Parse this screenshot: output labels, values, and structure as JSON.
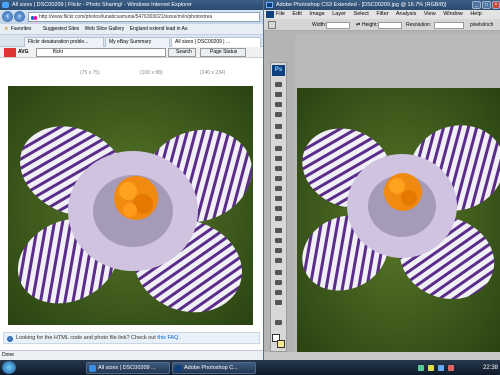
{
  "ie": {
    "title": "All sizes | DSC00209 | Flickr - Photo Sharing! - Windows Internet Explorer",
    "url": "http://www.flickr.com/photos/lunaticsamurai/5476303021/sizes/m/in/photostrea",
    "favorites_label": "Favorites",
    "suggested_sites": "Suggested Sites",
    "web_slice": "Web Slice Gallery",
    "england_link": "England extend lead in As",
    "tabs": [
      "Flickr desaturation proble...",
      "My eBay Summary",
      "All sizes | DSC00209 | ..."
    ],
    "avg_label": "AVG",
    "avg_search_value": "flickr",
    "search_button": "Search",
    "page_status_button": "Page Status",
    "sizes": [
      "(75 x 75)",
      "(100 x 88)",
      "(240 x 234)"
    ],
    "info_text": "Looking for the HTML code and photo file link? Check out",
    "info_link": "this FAQ.",
    "status": "Done"
  },
  "ps": {
    "title": "Adobe Photoshop CS3 Extended - [DSC00209.jpg @ 16.7% (RGB/8)]",
    "menu": [
      "File",
      "Edit",
      "Image",
      "Layer",
      "Select",
      "Filter",
      "Analysis",
      "View",
      "Window",
      "Help"
    ],
    "width_label": "Width:",
    "height_label": "Height:",
    "resolution_label": "Resolution:",
    "resolution_unit": "pixels/inch",
    "ps_logo": "Ps",
    "colors": {
      "foreground": "#ffffff",
      "background": "#f5e98f"
    }
  },
  "taskbar": {
    "items": [
      "All sizes | DSC00209 ...",
      "Adobe Photoshop C..."
    ],
    "clock": "22:38"
  }
}
